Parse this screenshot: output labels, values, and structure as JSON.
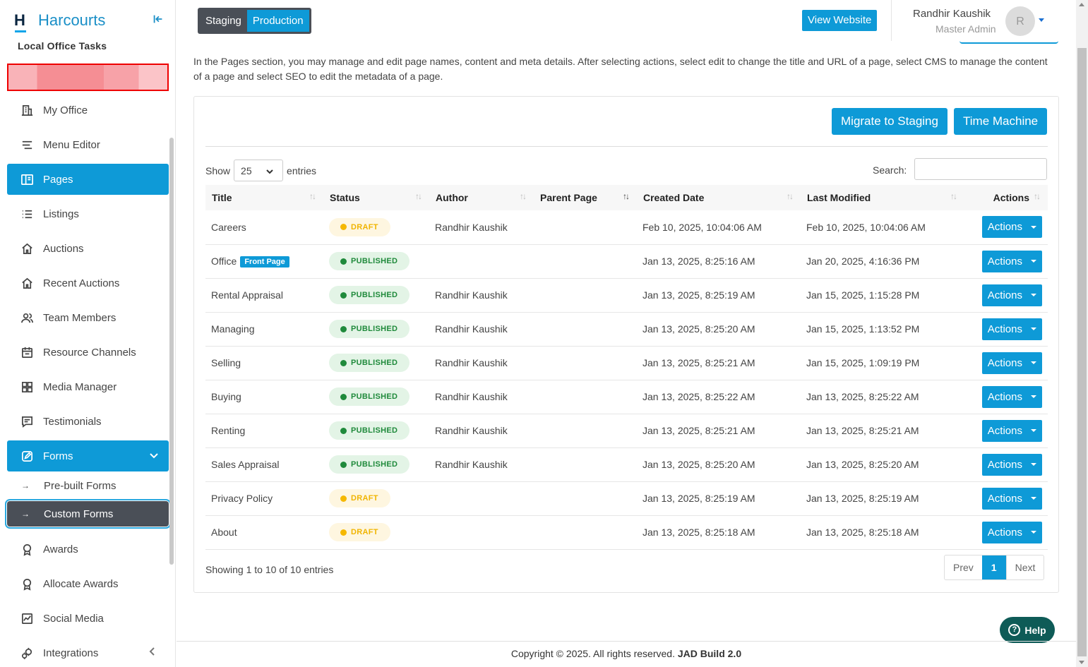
{
  "brand": {
    "logo_letter": "H",
    "name": "Harcourts"
  },
  "sidebar": {
    "section_title": "Local Office Tasks",
    "items": [
      {
        "label": "My Office",
        "icon": "building-icon"
      },
      {
        "label": "Menu Editor",
        "icon": "menu-lines-icon"
      },
      {
        "label": "Pages",
        "icon": "pages-icon",
        "active": true
      },
      {
        "label": "Listings",
        "icon": "list-icon"
      },
      {
        "label": "Auctions",
        "icon": "house-icon"
      },
      {
        "label": "Recent Auctions",
        "icon": "house-icon"
      },
      {
        "label": "Team Members",
        "icon": "people-icon"
      },
      {
        "label": "Resource Channels",
        "icon": "calendar-icon"
      },
      {
        "label": "Media Manager",
        "icon": "grid-icon"
      },
      {
        "label": "Testimonials",
        "icon": "comment-icon"
      },
      {
        "label": "Forms",
        "icon": "edit-icon",
        "active": true,
        "expanded": true
      },
      {
        "label": "Awards",
        "icon": "award-icon"
      },
      {
        "label": "Allocate Awards",
        "icon": "award-icon"
      },
      {
        "label": "Social Media",
        "icon": "chart-icon"
      },
      {
        "label": "Integrations",
        "icon": "gears-icon"
      }
    ],
    "forms_sub": [
      {
        "label": "Pre-built Forms"
      },
      {
        "label": "Custom Forms",
        "active": true
      }
    ]
  },
  "topbar": {
    "env": {
      "staging": "Staging",
      "production": "Production",
      "selected": "Production"
    },
    "view_website": "View Website",
    "user": {
      "name": "Randhir Kaushik",
      "role": "Master Admin",
      "initial": "R"
    }
  },
  "main": {
    "intro": "In the Pages section, you may manage and edit page names, content and meta details. After selecting actions, select edit to change the title and URL of a page, select CMS to manage the content of a page and select SEO to edit the metadata of a page.",
    "buttons": {
      "migrate": "Migrate to Staging",
      "time_machine": "Time Machine"
    },
    "show_label": "Show",
    "entries_label": "entries",
    "page_size": "25",
    "search_label": "Search:",
    "search_value": "",
    "columns": [
      "Title",
      "Status",
      "Author",
      "Parent Page",
      "Created Date",
      "Last Modified",
      "Actions"
    ],
    "rows": [
      {
        "title": "Careers",
        "tag": "",
        "status": "DRAFT",
        "author": "Randhir Kaushik",
        "parent": "",
        "created": "Feb 10, 2025, 10:04:06 AM",
        "modified": "Feb 10, 2025, 10:04:06 AM",
        "action": "Actions"
      },
      {
        "title": "Office",
        "tag": "Front Page",
        "status": "PUBLISHED",
        "author": "",
        "parent": "",
        "created": "Jan 13, 2025, 8:25:16 AM",
        "modified": "Jan 20, 2025, 4:16:36 PM",
        "action": "Actions"
      },
      {
        "title": "Rental Appraisal",
        "tag": "",
        "status": "PUBLISHED",
        "author": "Randhir Kaushik",
        "parent": "",
        "created": "Jan 13, 2025, 8:25:19 AM",
        "modified": "Jan 15, 2025, 1:15:28 PM",
        "action": "Actions"
      },
      {
        "title": "Managing",
        "tag": "",
        "status": "PUBLISHED",
        "author": "Randhir Kaushik",
        "parent": "",
        "created": "Jan 13, 2025, 8:25:20 AM",
        "modified": "Jan 15, 2025, 1:13:52 PM",
        "action": "Actions"
      },
      {
        "title": "Selling",
        "tag": "",
        "status": "PUBLISHED",
        "author": "Randhir Kaushik",
        "parent": "",
        "created": "Jan 13, 2025, 8:25:21 AM",
        "modified": "Jan 15, 2025, 1:09:19 PM",
        "action": "Actions"
      },
      {
        "title": "Buying",
        "tag": "",
        "status": "PUBLISHED",
        "author": "Randhir Kaushik",
        "parent": "",
        "created": "Jan 13, 2025, 8:25:22 AM",
        "modified": "Jan 13, 2025, 8:25:22 AM",
        "action": "Actions"
      },
      {
        "title": "Renting",
        "tag": "",
        "status": "PUBLISHED",
        "author": "Randhir Kaushik",
        "parent": "",
        "created": "Jan 13, 2025, 8:25:21 AM",
        "modified": "Jan 13, 2025, 8:25:21 AM",
        "action": "Actions"
      },
      {
        "title": "Sales Appraisal",
        "tag": "",
        "status": "PUBLISHED",
        "author": "Randhir Kaushik",
        "parent": "",
        "created": "Jan 13, 2025, 8:25:20 AM",
        "modified": "Jan 13, 2025, 8:25:20 AM",
        "action": "Actions"
      },
      {
        "title": "Privacy Policy",
        "tag": "",
        "status": "DRAFT",
        "author": "",
        "parent": "",
        "created": "Jan 13, 2025, 8:25:19 AM",
        "modified": "Jan 13, 2025, 8:25:19 AM",
        "action": "Actions"
      },
      {
        "title": "About",
        "tag": "",
        "status": "DRAFT",
        "author": "",
        "parent": "",
        "created": "Jan 13, 2025, 8:25:18 AM",
        "modified": "Jan 13, 2025, 8:25:18 AM",
        "action": "Actions"
      }
    ],
    "showing": "Showing 1 to 10 of 10 entries",
    "pager": {
      "prev": "Prev",
      "current": "1",
      "next": "Next"
    }
  },
  "help_label": "Help",
  "footer": {
    "text": "Copyright © 2025. All rights reserved.",
    "build": "JAD Build 2.0"
  },
  "colors": {
    "accent": "#0e9ad7",
    "dark": "#4a4f57",
    "help": "#0e5b57",
    "draft": "#f5b800",
    "published": "#1f8a3b"
  }
}
